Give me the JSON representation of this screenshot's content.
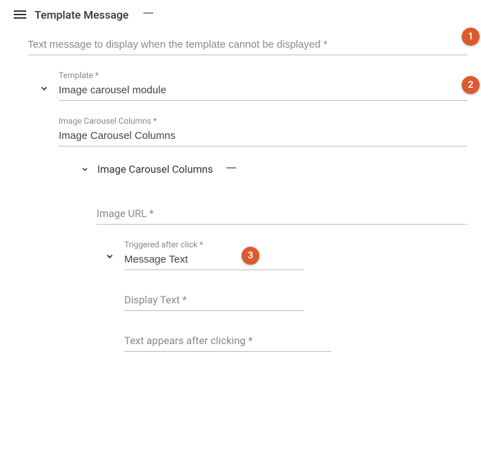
{
  "header": {
    "title": "Template Message"
  },
  "fields": {
    "altText": {
      "placeholder": "Text message to display when the template cannot be displayed *"
    },
    "template": {
      "label": "Template *",
      "value": "Image carousel module"
    },
    "columnsField": {
      "label": "Image Carousel Columns *",
      "value": "Image Carousel Columns"
    },
    "columnsSection": {
      "title": "Image Carousel Columns"
    },
    "imageUrl": {
      "placeholder": "Image URL *"
    },
    "triggered": {
      "label": "Triggered after click *",
      "value": "Message Text"
    },
    "displayText": {
      "placeholder": "Display Text *"
    },
    "textAfter": {
      "placeholder": "Text appears after clicking *"
    }
  },
  "badges": {
    "b1": "1",
    "b2": "2",
    "b3": "3"
  }
}
